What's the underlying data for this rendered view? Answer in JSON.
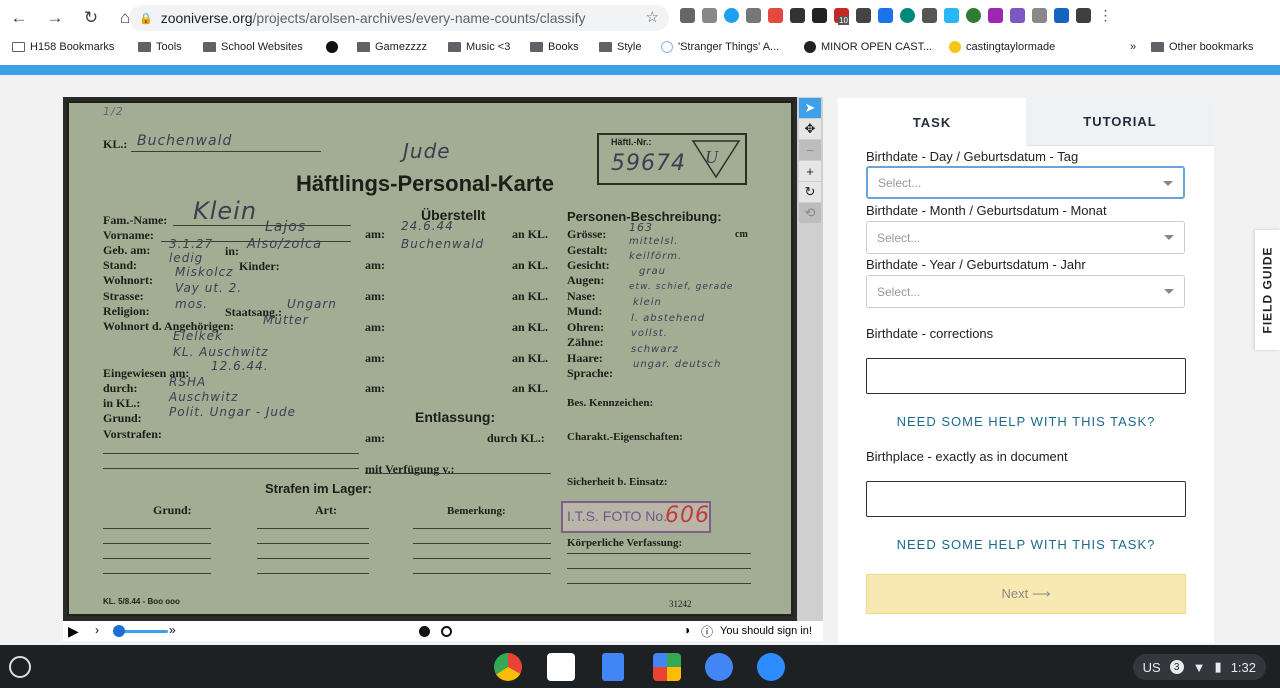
{
  "browser": {
    "url_host": "zooniverse.org",
    "url_path": "/projects/arolsen-archives/every-name-counts/classify",
    "bookmarks": [
      {
        "label": "H158 Bookmarks"
      },
      {
        "label": "Tools"
      },
      {
        "label": "School Websites"
      },
      {
        "label": "Gamezzzz"
      },
      {
        "label": "Music <3"
      },
      {
        "label": "Books"
      },
      {
        "label": "Style"
      },
      {
        "label": "'Stranger Things' A..."
      },
      {
        "label": "MINOR OPEN CAST..."
      },
      {
        "label": "castingtaylormade"
      },
      {
        "label": "Other bookmarks"
      }
    ],
    "extension_badge": "10"
  },
  "document": {
    "kl_label": "KL.:",
    "kl_value": "Buchenwald",
    "jude": "Jude",
    "title": "Häftlings-Personal-Karte",
    "haftl_label": "Häftl.-Nr.:",
    "haftl_number": "59674",
    "fam_name_label": "Fam.-Name:",
    "fam_name": "Klein",
    "vorname_label": "Vorname:",
    "vorname": "Lajos",
    "geb_label": "Geb. am:",
    "geb_value": "3.1.27",
    "geb_in_label": "in:",
    "geb_in": "Also/zolca",
    "stand_label": "Stand:",
    "stand": "ledig",
    "kinder_label": "Kinder:",
    "wohnort_label": "Wohnort:",
    "wohnort": "Miskolcz",
    "strasse_label": "Strasse:",
    "strasse": "Vay ut. 2.",
    "religion_label": "Religion:",
    "religion": "mos.",
    "staatsang_label": "Staatsang.:",
    "staatsang": "Ungarn",
    "wohnort_ang_label": "Wohnort d. Angehörigen:",
    "wohnort_ang": "Mutter",
    "wohnort_ang2": "Elelkek",
    "wohnort_ang3": "KL. Auschwitz",
    "eingewiesen_label": "Eingewiesen am:",
    "eingewiesen": "12.6.44.",
    "durch_label": "durch:",
    "durch": "RSHA",
    "in_kl_label": "in KL.:",
    "in_kl": "Auschwitz",
    "grund_label": "Grund:",
    "grund": "Polit. Ungar - Jude",
    "vorstrafen_label": "Vorstrafen:",
    "ueberstellt": "Überstellt",
    "am_label": "am:",
    "an_kl_label": "an KL.",
    "am_value": "24.6.44",
    "an_kl_value": "Buchenwald",
    "durch_kl_label": "durch KL.:",
    "mit_verfuegung": "mit Verfügung v.:",
    "entlassung": "Entlassung:",
    "personen_beschreibung": "Personen-Beschreibung:",
    "groesse_label": "Grösse:",
    "groesse": "163",
    "cm": "cm",
    "gestalt_label": "Gestalt:",
    "gestalt": "mittelsl.",
    "gesicht_label": "Gesicht:",
    "gesicht": "keilförm.",
    "augen_label": "Augen:",
    "augen": "grau",
    "nase_label": "Nase:",
    "nase": "etw. schief, gerade",
    "mund_label": "Mund:",
    "mund": "klein",
    "ohren_label": "Ohren:",
    "ohren": "l. abstehend",
    "zaehne_label": "Zähne:",
    "zaehne": "vollst.",
    "haare_label": "Haare:",
    "haare": "schwarz",
    "sprache_label": "Sprache:",
    "sprache": "ungar. deutsch",
    "kennzeichen_label": "Bes. Kennzeichen:",
    "charakt_label": "Charakt.-Eigenschaften:",
    "sicherheit_label": "Sicherheit b. Einsatz:",
    "koerperliche_label": "Körperliche Verfassung:",
    "strafen_label": "Strafen im Lager:",
    "grund_col": "Grund:",
    "art_col": "Art:",
    "bemerkung_col": "Bemerkung:",
    "its_stamp": "I.T.S. FOTO No.",
    "its_number": "606",
    "footer_left": "KL. 5/8.44 - Boo ooo",
    "footer_right": "31242"
  },
  "viewer": {
    "sign_in": "You should sign in!"
  },
  "task_panel": {
    "tabs": [
      {
        "label": "TASK"
      },
      {
        "label": "TUTORIAL"
      }
    ],
    "fields": [
      {
        "label": "Birthdate - Day / Geburtsdatum - Tag",
        "placeholder": "Select..."
      },
      {
        "label": "Birthdate - Month / Geburtsdatum - Monat",
        "placeholder": "Select..."
      },
      {
        "label": "Birthdate - Year / Geburtsdatum - Jahr",
        "placeholder": "Select..."
      }
    ],
    "corrections_label": "Birthdate - corrections",
    "help_label": "NEED SOME HELP WITH THIS TASK?",
    "birthplace_label": "Birthplace - exactly as in document",
    "next_label": "Next ⟶"
  },
  "field_guide": "FIELD GUIDE",
  "shelf": {
    "locale": "US",
    "notification_count": "3",
    "time": "1:32"
  }
}
